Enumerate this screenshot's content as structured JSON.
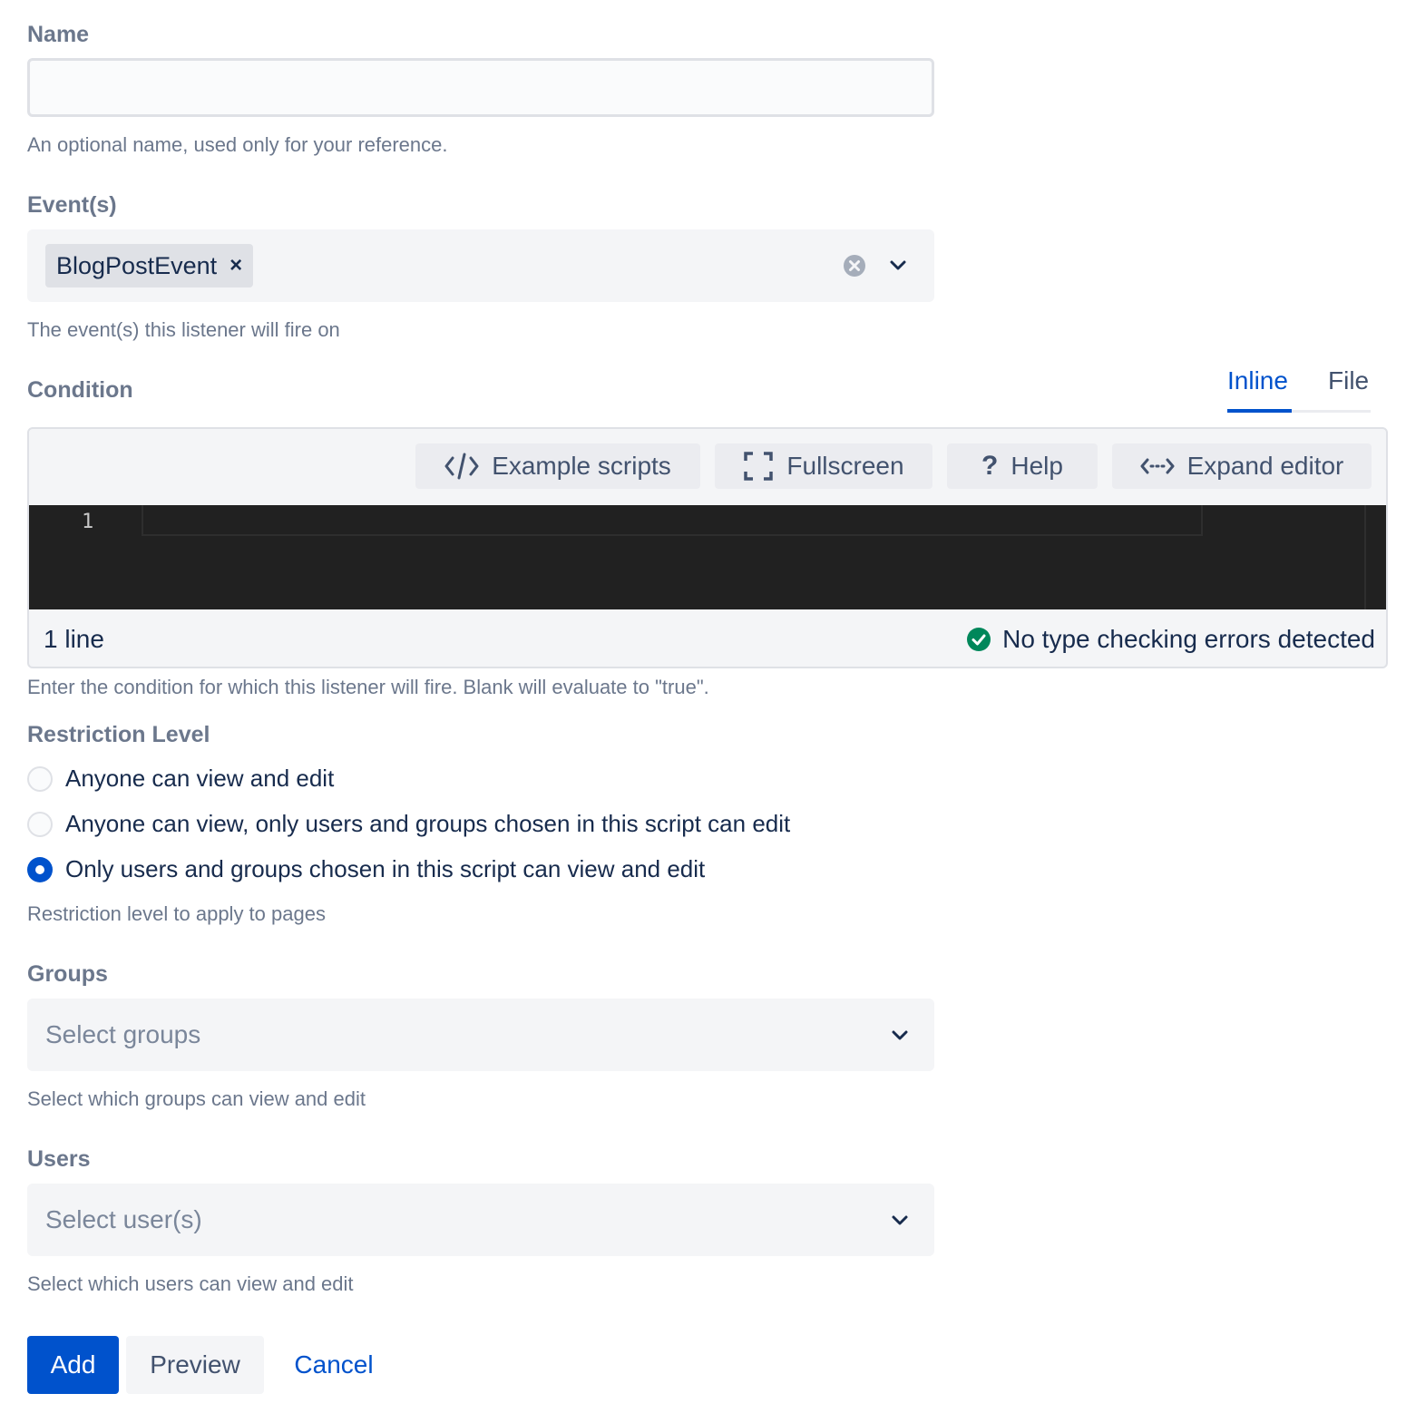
{
  "name_field": {
    "label": "Name",
    "value": "",
    "placeholder": "",
    "help": "An optional name, used only for your reference."
  },
  "events_field": {
    "label": "Event(s)",
    "selected": [
      "BlogPostEvent"
    ],
    "remove_glyph": "×",
    "help": "The event(s) this listener will fire on"
  },
  "condition": {
    "label": "Condition",
    "tabs": [
      {
        "label": "Inline",
        "active": true
      },
      {
        "label": "File",
        "active": false
      }
    ],
    "toolbar": {
      "example_scripts": "Example scripts",
      "fullscreen": "Fullscreen",
      "help": "Help",
      "help_glyph": "?",
      "expand_editor": "Expand editor"
    },
    "line_number": "1",
    "line_count": "1 line",
    "type_check_status": "No type checking errors detected",
    "help": "Enter the condition for which this listener will fire. Blank will evaluate to \"true\"."
  },
  "restriction_level": {
    "label": "Restriction Level",
    "options": [
      {
        "label": "Anyone can view and edit",
        "selected": false
      },
      {
        "label": "Anyone can view, only users and groups chosen in this script can edit",
        "selected": false
      },
      {
        "label": "Only users and groups chosen in this script can view and edit",
        "selected": true
      }
    ],
    "help": "Restriction level to apply to pages"
  },
  "groups_field": {
    "label": "Groups",
    "placeholder": "Select groups",
    "help": "Select which groups can view and edit"
  },
  "users_field": {
    "label": "Users",
    "placeholder": "Select user(s)",
    "help": "Select which users can view and edit"
  },
  "actions": {
    "add": "Add",
    "preview": "Preview",
    "cancel": "Cancel"
  },
  "colors": {
    "primary": "#0052CC",
    "success": "#00875A",
    "label_text": "#6B778C",
    "editor_bg": "#212121"
  },
  "icons": [
    "code-icon",
    "fullscreen-icon",
    "help-icon",
    "expand-icon",
    "clear-icon",
    "chevron-down-icon",
    "success-check-icon"
  ]
}
